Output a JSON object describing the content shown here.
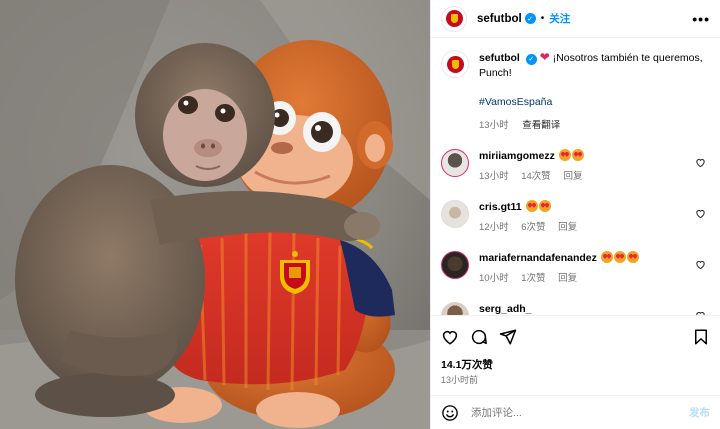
{
  "post": {
    "username": "sefutbol",
    "follow_label": "关注",
    "more_label": "•••",
    "caption_text": "¡Nosotros también te queremos, Punch!",
    "hashtag": "#VamosEspaña",
    "caption_time": "13小时",
    "see_translation": "查看翻译",
    "likes": "14.1万次赞",
    "posted_time": "13小时前"
  },
  "comments": [
    {
      "username": "miriiamgomezz",
      "emoji_count": 2,
      "time": "13小时",
      "likes": "14次赞",
      "reply": "回复"
    },
    {
      "username": "cris.gt11",
      "emoji_count": 2,
      "time": "12小时",
      "likes": "6次赞",
      "reply": "回复"
    },
    {
      "username": "mariafernandafenandez",
      "emoji_count": 3,
      "time": "10小时",
      "likes": "1次赞",
      "reply": "回复"
    },
    {
      "username": "serg_adh_"
    }
  ],
  "composer": {
    "placeholder": "添加评论...",
    "post_label": "发布"
  },
  "icons": {
    "like": "heart-icon",
    "comment": "comment-icon",
    "share": "share-icon",
    "save": "bookmark-icon",
    "emoji": "emoji-icon",
    "verified": "verified-badge-icon"
  },
  "colors": {
    "accent": "#0095f6",
    "post_disabled": "#b2dffc",
    "secondary_text": "#737373",
    "hashtag": "#00376b"
  }
}
